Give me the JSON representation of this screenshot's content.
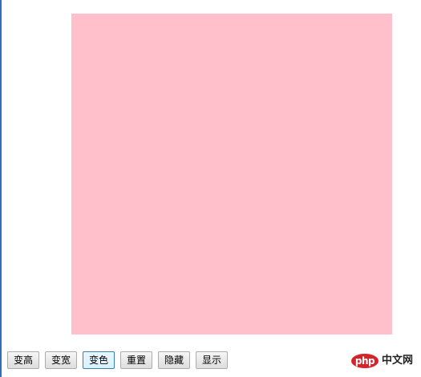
{
  "box": {
    "color": "#ffc0cb"
  },
  "controls": {
    "grow_height_label": "变高",
    "grow_width_label": "变宽",
    "change_color_label": "变色",
    "reset_label": "重置",
    "hide_label": "隐藏",
    "show_label": "显示"
  },
  "watermark": {
    "logo_label": "php",
    "site_label": "中文网"
  }
}
